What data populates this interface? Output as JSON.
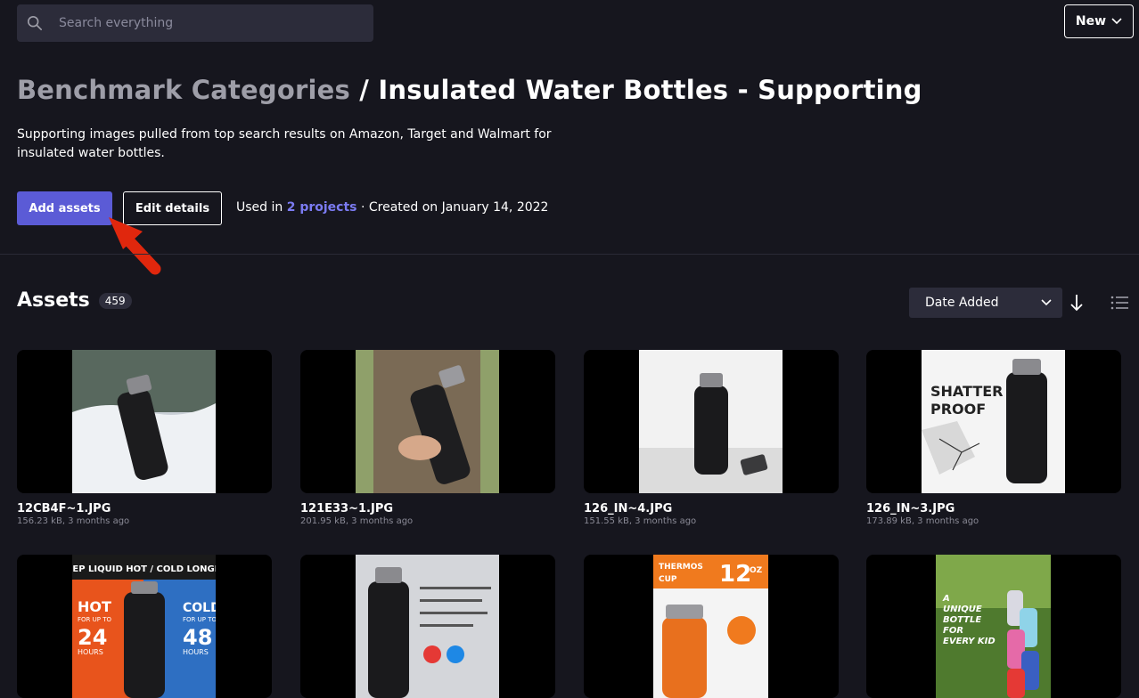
{
  "search": {
    "placeholder": "Search everything"
  },
  "header": {
    "new_label": "New"
  },
  "breadcrumb": {
    "parent": "Benchmark Categories",
    "separator": " / ",
    "current": "Insulated Water Bottles - Supporting"
  },
  "description": "Supporting images pulled from top search results on Amazon, Target and Walmart for insulated water bottles.",
  "actions": {
    "add_assets": "Add assets",
    "edit_details": "Edit details"
  },
  "meta": {
    "used_in_prefix": "Used in ",
    "projects_link": "2 projects",
    "created": " · Created on January 14, 2022"
  },
  "assets": {
    "title": "Assets",
    "count": "459",
    "sort_label": "Date Added",
    "items": [
      {
        "name": "12CB4F~1.JPG",
        "info": "156.23 kB, 3 months ago"
      },
      {
        "name": "121E33~1.JPG",
        "info": "201.95 kB, 3 months ago"
      },
      {
        "name": "126_IN~4.JPG",
        "info": "151.55 kB, 3 months ago"
      },
      {
        "name": "126_IN~3.JPG",
        "info": "173.89 kB, 3 months ago"
      }
    ],
    "image_text": {
      "shatter_1": "SHATTER",
      "shatter_2": "PROOF",
      "keep_liquid": "KEEP LIQUID HOT / COLD LONGER",
      "hot": "HOT",
      "hot_for_up_to": "FOR UP TO",
      "hot_hours": "24",
      "hot_unit": "HOURS",
      "cold": "COLD",
      "cold_for_up_to": "FOR UP TO",
      "cold_hours": "48",
      "cold_unit": "HOURS",
      "thermos": "THERMOS",
      "cup": "CUP",
      "oz_num": "12",
      "oz": "OZ",
      "unique_1": "A",
      "unique_2": "UNIQUE",
      "unique_3": "BOTTLE",
      "unique_4": "FOR",
      "unique_5": "EVERY KID"
    }
  },
  "colors": {
    "accent": "#5b5bd6",
    "link": "#7b7bf2",
    "background": "#16161e",
    "arrow": "#e0270d"
  }
}
